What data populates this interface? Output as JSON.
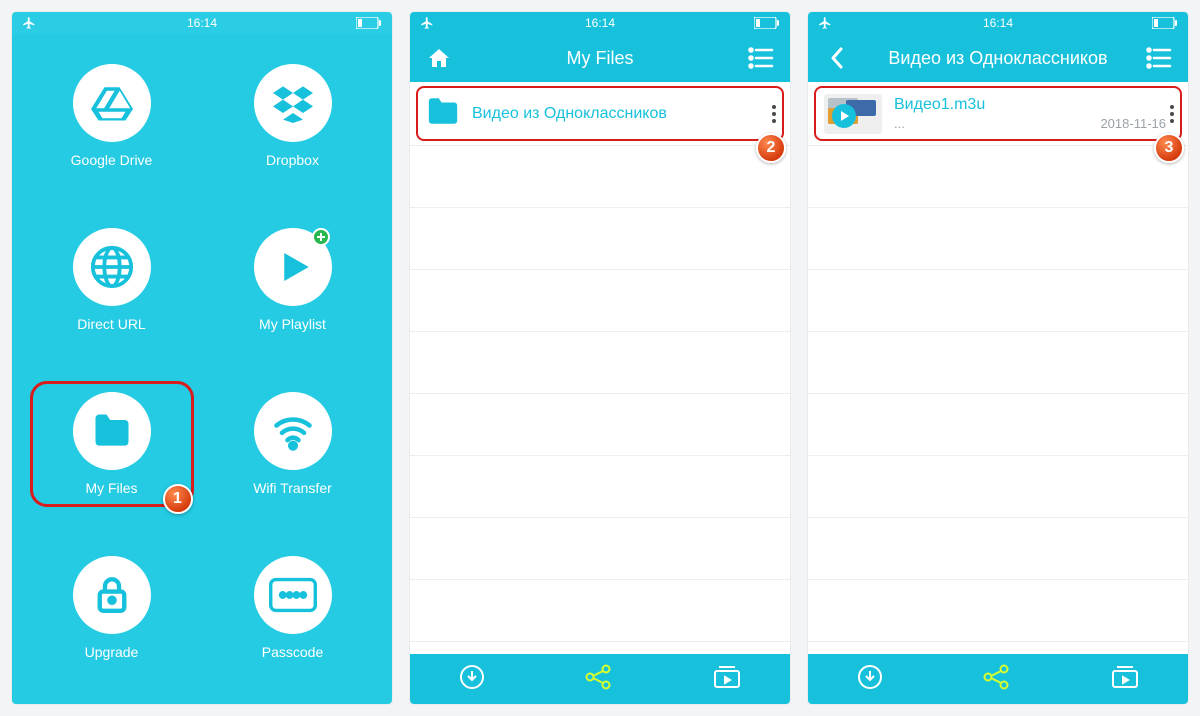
{
  "colors": {
    "accent": "#17c1dc",
    "highlight": "#d81b1b",
    "badge": "#e2501a"
  },
  "status": {
    "time": "16:14"
  },
  "screen1": {
    "items": [
      {
        "label": "Google Drive",
        "icon": "google-drive"
      },
      {
        "label": "Dropbox",
        "icon": "dropbox"
      },
      {
        "label": "Direct URL",
        "icon": "globe"
      },
      {
        "label": "My Playlist",
        "icon": "play",
        "badge": true
      },
      {
        "label": "My Files",
        "icon": "folder",
        "highlighted": true
      },
      {
        "label": "Wifi Transfer",
        "icon": "wifi"
      },
      {
        "label": "Upgrade",
        "icon": "lock"
      },
      {
        "label": "Passcode",
        "icon": "passcode"
      }
    ],
    "step_badge": "1"
  },
  "screen2": {
    "title": "My Files",
    "folder": "Видео из Одноклассников",
    "step_badge": "2"
  },
  "screen3": {
    "title": "Видео из Одноклассников",
    "file": {
      "name": "Видео1.m3u",
      "size": "...",
      "date": "2018-11-16"
    },
    "step_badge": "3"
  }
}
